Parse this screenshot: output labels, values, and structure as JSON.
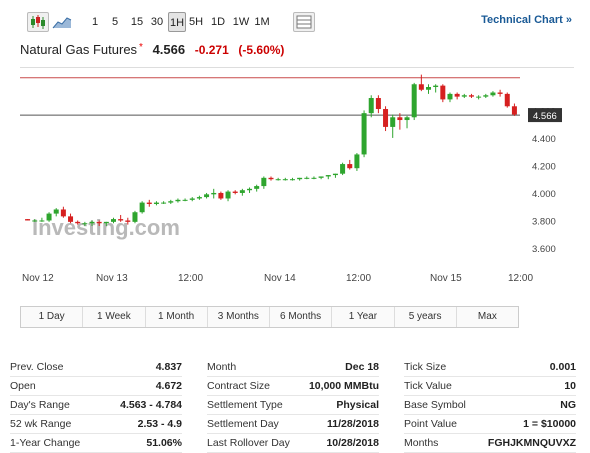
{
  "toolbar": {
    "candlestick_icon": "candlestick-icon",
    "area_icon": "area-chart-icon",
    "intervals": [
      "1",
      "5",
      "15",
      "30",
      "1H",
      "5H",
      "1D",
      "1W",
      "1M"
    ],
    "active_interval": "1H",
    "table_icon": "table-icon",
    "tech_chart_label": "Technical Chart »"
  },
  "title": {
    "name": "Natural Gas Futures",
    "star": "*",
    "price": "4.566",
    "change": "-0.271",
    "change_pct": "(-5.60%)"
  },
  "chart_data": {
    "type": "candlestick",
    "x_labels": [
      "Nov 12",
      "Nov 13",
      "12:00",
      "Nov 14",
      "12:00",
      "Nov 15",
      "12:00"
    ],
    "y_ticks": [
      "3.600",
      "3.800",
      "4.000",
      "4.200",
      "4.400",
      "4.600"
    ],
    "ylim": [
      3.6,
      4.85
    ],
    "current_price_label": "4.566",
    "current_price": 4.566,
    "prev_close_line": 4.837,
    "watermark": "Investing.com",
    "up_color": "#2ea52e",
    "down_color": "#d62020",
    "candles": [
      [
        3.81,
        3.81,
        3.8,
        3.8
      ],
      [
        3.8,
        3.81,
        3.79,
        3.8
      ],
      [
        3.8,
        3.82,
        3.79,
        3.8
      ],
      [
        3.8,
        3.86,
        3.79,
        3.85
      ],
      [
        3.85,
        3.89,
        3.83,
        3.88
      ],
      [
        3.88,
        3.9,
        3.82,
        3.83
      ],
      [
        3.83,
        3.85,
        3.78,
        3.79
      ],
      [
        3.79,
        3.8,
        3.77,
        3.78
      ],
      [
        3.78,
        3.79,
        3.76,
        3.78
      ],
      [
        3.78,
        3.8,
        3.76,
        3.79
      ],
      [
        3.79,
        3.8,
        3.76,
        3.78
      ],
      [
        3.78,
        3.79,
        3.76,
        3.79
      ],
      [
        3.79,
        3.82,
        3.78,
        3.81
      ],
      [
        3.81,
        3.84,
        3.79,
        3.8
      ],
      [
        3.8,
        3.82,
        3.77,
        3.79
      ],
      [
        3.79,
        3.87,
        3.78,
        3.86
      ],
      [
        3.86,
        3.94,
        3.85,
        3.93
      ],
      [
        3.93,
        3.95,
        3.9,
        3.92
      ],
      [
        3.92,
        3.94,
        3.91,
        3.93
      ],
      [
        3.93,
        3.94,
        3.92,
        3.93
      ],
      [
        3.93,
        3.95,
        3.92,
        3.94
      ],
      [
        3.94,
        3.96,
        3.93,
        3.95
      ],
      [
        3.95,
        3.96,
        3.94,
        3.95
      ],
      [
        3.95,
        3.97,
        3.94,
        3.96
      ],
      [
        3.96,
        3.98,
        3.95,
        3.97
      ],
      [
        3.97,
        4.0,
        3.96,
        3.99
      ],
      [
        3.99,
        4.03,
        3.96,
        4.0
      ],
      [
        4.0,
        4.01,
        3.95,
        3.96
      ],
      [
        3.96,
        4.02,
        3.94,
        4.01
      ],
      [
        4.01,
        4.02,
        3.99,
        4.0
      ],
      [
        4.0,
        4.03,
        3.98,
        4.02
      ],
      [
        4.02,
        4.04,
        4.0,
        4.03
      ],
      [
        4.03,
        4.06,
        4.01,
        4.05
      ],
      [
        4.05,
        4.12,
        4.03,
        4.11
      ],
      [
        4.11,
        4.12,
        4.09,
        4.1
      ],
      [
        4.1,
        4.11,
        4.09,
        4.1
      ],
      [
        4.1,
        4.11,
        4.09,
        4.1
      ],
      [
        4.1,
        4.11,
        4.09,
        4.1
      ],
      [
        4.1,
        4.11,
        4.09,
        4.11
      ],
      [
        4.11,
        4.12,
        4.1,
        4.11
      ],
      [
        4.11,
        4.12,
        4.1,
        4.11
      ],
      [
        4.11,
        4.12,
        4.1,
        4.12
      ],
      [
        4.12,
        4.13,
        4.1,
        4.13
      ],
      [
        4.13,
        4.14,
        4.11,
        4.14
      ],
      [
        4.14,
        4.22,
        4.13,
        4.21
      ],
      [
        4.21,
        4.24,
        4.17,
        4.18
      ],
      [
        4.18,
        4.29,
        4.16,
        4.28
      ],
      [
        4.28,
        4.6,
        4.26,
        4.58
      ],
      [
        4.58,
        4.71,
        4.55,
        4.69
      ],
      [
        4.69,
        4.71,
        4.58,
        4.61
      ],
      [
        4.61,
        4.63,
        4.45,
        4.48
      ],
      [
        4.48,
        4.57,
        4.4,
        4.55
      ],
      [
        4.55,
        4.58,
        4.46,
        4.53
      ],
      [
        4.53,
        4.56,
        4.47,
        4.55
      ],
      [
        4.55,
        4.8,
        4.53,
        4.79
      ],
      [
        4.79,
        4.86,
        4.74,
        4.75
      ],
      [
        4.75,
        4.79,
        4.72,
        4.77
      ],
      [
        4.77,
        4.79,
        4.73,
        4.78
      ],
      [
        4.78,
        4.79,
        4.66,
        4.68
      ],
      [
        4.68,
        4.73,
        4.66,
        4.72
      ],
      [
        4.72,
        4.73,
        4.68,
        4.7
      ],
      [
        4.7,
        4.72,
        4.69,
        4.71
      ],
      [
        4.71,
        4.72,
        4.69,
        4.7
      ],
      [
        4.7,
        4.71,
        4.68,
        4.7
      ],
      [
        4.7,
        4.72,
        4.69,
        4.71
      ],
      [
        4.71,
        4.74,
        4.7,
        4.73
      ],
      [
        4.73,
        4.75,
        4.7,
        4.72
      ],
      [
        4.72,
        4.73,
        4.62,
        4.63
      ],
      [
        4.63,
        4.65,
        4.56,
        4.57
      ]
    ]
  },
  "ranges": [
    "1 Day",
    "1 Week",
    "1 Month",
    "3 Months",
    "6 Months",
    "1 Year",
    "5 years",
    "Max"
  ],
  "stats": [
    [
      {
        "label": "Prev. Close",
        "value": "4.837"
      },
      {
        "label": "Open",
        "value": "4.672"
      },
      {
        "label": "Day's Range",
        "value": "4.563 - 4.784"
      },
      {
        "label": "52 wk Range",
        "value": "2.53 - 4.9"
      },
      {
        "label": "1-Year Change",
        "value": "51.06%"
      }
    ],
    [
      {
        "label": "Month",
        "value": "Dec 18"
      },
      {
        "label": "Contract Size",
        "value": "10,000 MMBtu"
      },
      {
        "label": "Settlement Type",
        "value": "Physical"
      },
      {
        "label": "Settlement Day",
        "value": "11/28/2018"
      },
      {
        "label": "Last Rollover Day",
        "value": "10/28/2018"
      }
    ],
    [
      {
        "label": "Tick Size",
        "value": "0.001"
      },
      {
        "label": "Tick Value",
        "value": "10"
      },
      {
        "label": "Base Symbol",
        "value": "NG"
      },
      {
        "label": "Point Value",
        "value": "1 = $10000"
      },
      {
        "label": "Months",
        "value": "FGHJKMNQUVXZ"
      }
    ]
  ]
}
